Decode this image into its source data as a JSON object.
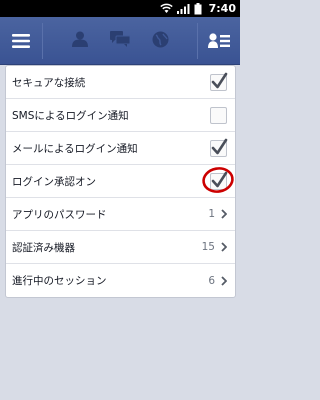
{
  "status_bar": {
    "time": "7:40",
    "icons": [
      "wifi-icon",
      "signal-icon",
      "battery-icon"
    ]
  },
  "app_bar": {
    "left_icon": "menu-icon",
    "center_icons": [
      "friend-requests-icon",
      "messages-icon",
      "notifications-globe-icon"
    ],
    "right_icon": "friends-list-icon"
  },
  "settings": {
    "items": [
      {
        "label": "セキュアな接続",
        "type": "checkbox",
        "checked": true
      },
      {
        "label": "SMSによるログイン通知",
        "type": "checkbox",
        "checked": false
      },
      {
        "label": "メールによるログイン通知",
        "type": "checkbox",
        "checked": true
      },
      {
        "label": "ログイン承認オン",
        "type": "checkbox",
        "checked": true,
        "highlighted": true
      },
      {
        "label": "アプリのパスワード",
        "type": "link",
        "count": "1"
      },
      {
        "label": "認証済み機器",
        "type": "link",
        "count": "15"
      },
      {
        "label": "進行中のセッション",
        "type": "link",
        "count": "6"
      }
    ]
  },
  "colors": {
    "app_bar": "#3b5998",
    "background": "#d8dce6",
    "highlight_ring": "#cc0000"
  }
}
